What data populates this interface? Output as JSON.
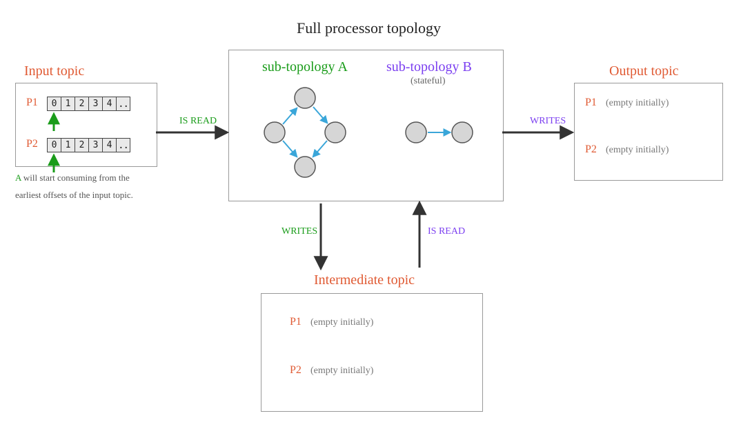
{
  "title": "Full processor topology",
  "input_topic": {
    "title": "Input topic",
    "partitions": [
      {
        "label": "P1",
        "offsets": [
          "0",
          "1",
          "2",
          "3",
          "4",
          ".."
        ]
      },
      {
        "label": "P2",
        "offsets": [
          "0",
          "1",
          "2",
          "3",
          "4",
          ".."
        ]
      }
    ],
    "caption_parts": {
      "prefix": "",
      "a": "A",
      "rest1": " will start consuming from the",
      "rest2": "earliest offsets of the input topic."
    }
  },
  "processor": {
    "sub_a": {
      "title": "sub-topology A"
    },
    "sub_b": {
      "title": "sub-topology B",
      "note": "(stateful)"
    }
  },
  "arrows": {
    "is_read_a": "IS READ",
    "writes_a": "WRITES",
    "is_read_b": "IS READ",
    "writes_b": "WRITES"
  },
  "intermediate_topic": {
    "title": "Intermediate topic",
    "partitions": [
      {
        "label": "P1",
        "status": "(empty initially)"
      },
      {
        "label": "P2",
        "status": "(empty initially)"
      }
    ]
  },
  "output_topic": {
    "title": "Output topic",
    "partitions": [
      {
        "label": "P1",
        "status": "(empty initially)"
      },
      {
        "label": "P2",
        "status": "(empty initially)"
      }
    ]
  },
  "colors": {
    "orange": "#e05a33",
    "green": "#1a9c1a",
    "purple": "#7b3ff0",
    "node_fill": "#d6d6d6",
    "node_stroke": "#555",
    "arrow_dark": "#333",
    "arrow_blue": "#3aa6d9"
  }
}
